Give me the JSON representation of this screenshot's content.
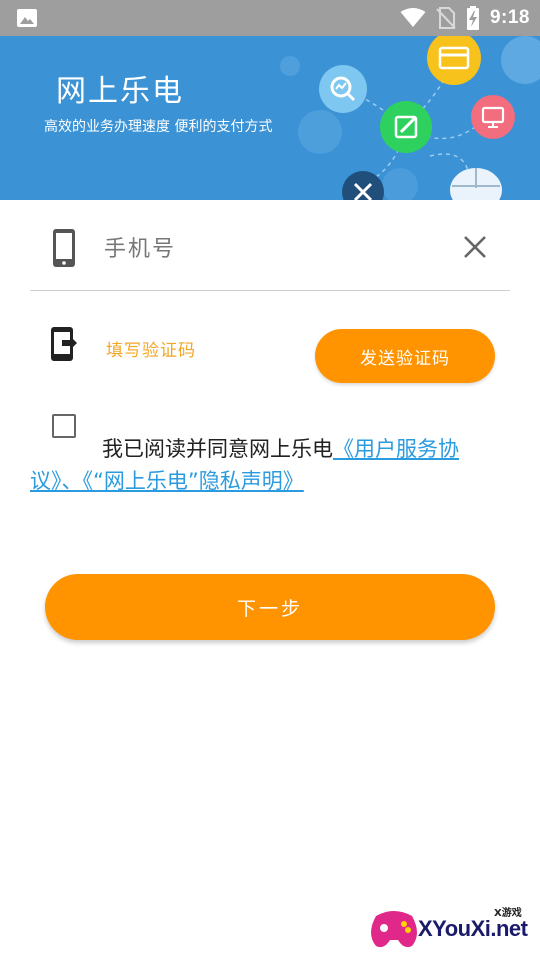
{
  "status_bar": {
    "time": "9:18",
    "icons": [
      "image-icon",
      "wifi-icon",
      "no-sim-icon",
      "battery-charging-icon"
    ]
  },
  "banner": {
    "title": "网上乐电",
    "subtitle": "高效的业务办理速度  便利的支付方式",
    "icons": [
      "search-chart-icon",
      "card-icon",
      "edit-icon",
      "monitor-icon",
      "tools-icon",
      "mouse-icon"
    ],
    "background": "#3b93d6"
  },
  "phone_field": {
    "placeholder": "手机号",
    "value": "",
    "icons": [
      "phone-icon",
      "clear-icon"
    ]
  },
  "code_field": {
    "placeholder": "填写验证码",
    "value": "",
    "icon": "exit-phone-icon"
  },
  "send_code_button": {
    "label": "发送验证码"
  },
  "agreement": {
    "checked": false,
    "prefix": "我已阅读并同意网上乐电",
    "link": "《用户服务协议》、《“网上乐电”隐私声明》"
  },
  "next_button": {
    "label": "下一步"
  },
  "watermark": {
    "main": "XYouXi.net",
    "tag": "X游戏"
  },
  "colors": {
    "accent": "#ff9300",
    "link": "#2b9be0",
    "status_bar": "#9e9e9e"
  }
}
